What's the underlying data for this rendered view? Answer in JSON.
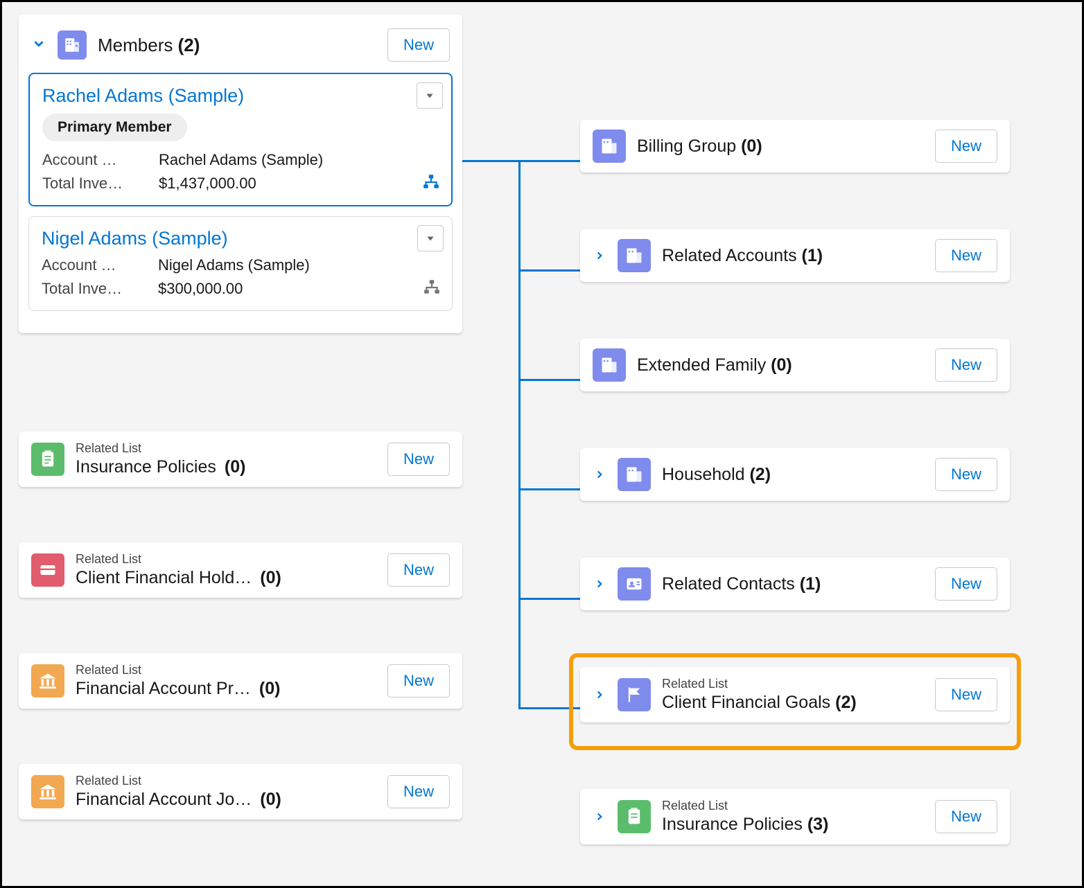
{
  "buttons": {
    "new": "New"
  },
  "labels": {
    "related_list": "Related List"
  },
  "members_section": {
    "title": "Members",
    "count": "(2)"
  },
  "members": [
    {
      "name": "Rachel Adams (Sample)",
      "chip": "Primary Member",
      "account_label": "Account …",
      "account_value": "Rachel Adams (Sample)",
      "invest_label": "Total Inve…",
      "invest_value": "$1,437,000.00",
      "selected": true
    },
    {
      "name": "Nigel Adams (Sample)",
      "account_label": "Account …",
      "account_value": "Nigel Adams (Sample)",
      "invest_label": "Total Inve…",
      "invest_value": "$300,000.00",
      "selected": false
    }
  ],
  "left_lists": [
    {
      "title": "Insurance Policies",
      "count": "(0)",
      "icon": "clipboard",
      "color": "green"
    },
    {
      "title": "Client Financial Hold…",
      "count": "(0)",
      "icon": "card",
      "color": "red"
    },
    {
      "title": "Financial Account Pr…",
      "count": "(0)",
      "icon": "bank",
      "color": "orange"
    },
    {
      "title": "Financial Account Jo…",
      "count": "(0)",
      "icon": "bank",
      "color": "orange"
    }
  ],
  "right_lists": [
    {
      "title": "Billing Group",
      "count": "(0)",
      "icon": "building",
      "color": "purple",
      "chevron": false,
      "subtitle": false
    },
    {
      "title": "Related Accounts",
      "count": "(1)",
      "icon": "building",
      "color": "purple",
      "chevron": true,
      "subtitle": false
    },
    {
      "title": "Extended Family",
      "count": "(0)",
      "icon": "building",
      "color": "purple",
      "chevron": false,
      "subtitle": false
    },
    {
      "title": "Household",
      "count": "(2)",
      "icon": "building",
      "color": "purple",
      "chevron": true,
      "subtitle": false
    },
    {
      "title": "Related Contacts",
      "count": "(1)",
      "icon": "contact",
      "color": "purple",
      "chevron": true,
      "subtitle": false
    },
    {
      "title": "Client Financial Goals",
      "count": "(2)",
      "icon": "flag",
      "color": "purple",
      "chevron": true,
      "subtitle": true,
      "highlighted": true
    },
    {
      "title": "Insurance Policies",
      "count": "(3)",
      "icon": "clipboard",
      "color": "green",
      "chevron": true,
      "subtitle": true
    }
  ]
}
